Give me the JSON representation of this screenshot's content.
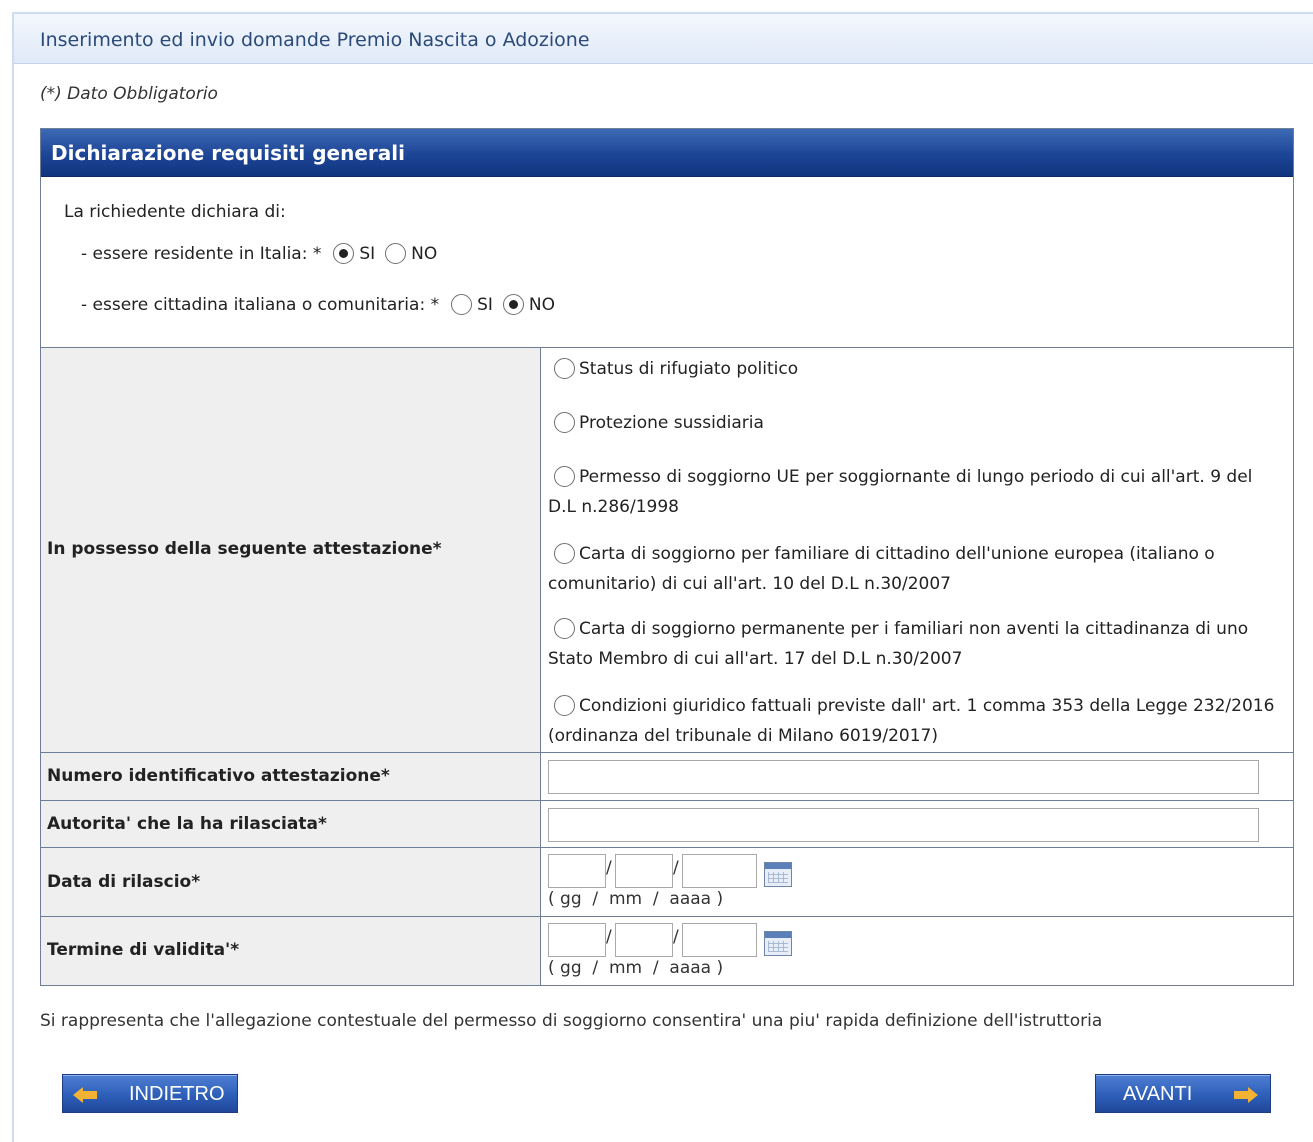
{
  "page": {
    "title": "Inserimento ed invio domande Premio Nascita o Adozione",
    "required_note": "(*) Dato Obbligatorio"
  },
  "section": {
    "title": "Dichiarazione requisiti generali",
    "intro": "La richiedente dichiara di:",
    "residente": {
      "question": "- essere residente in Italia: *",
      "options": [
        "SI",
        "NO"
      ],
      "selected": "SI"
    },
    "cittadina": {
      "question": "- essere cittadina italiana o comunitaria: *",
      "options": [
        "SI",
        "NO"
      ],
      "selected": "NO"
    },
    "attestazione": {
      "label": "In possesso della seguente attestazione*",
      "options": [
        "Status di rifugiato politico",
        "Protezione sussidiaria",
        "Permesso di soggiorno UE per soggiornante di lungo periodo di cui all'art. 9 del D.L n.286/1998",
        "Carta di soggiorno per familiare di cittadino dell'unione europea (italiano o comunitario) di cui all'art. 10 del D.L n.30/2007",
        "Carta di soggiorno permanente per i familiari non aventi la cittadinanza di uno Stato Membro di cui all'art. 17 del D.L n.30/2007",
        "Condizioni giuridico fattuali previste dall' art. 1 comma 353 della Legge 232/2016 (ordinanza del tribunale di Milano 6019/2017)"
      ]
    },
    "numero": {
      "label": "Numero identificativo attestazione*",
      "value": ""
    },
    "autorita": {
      "label": "Autorita' che la ha rilasciata*",
      "value": ""
    },
    "data_rilascio": {
      "label": "Data di rilascio*",
      "day": "",
      "month": "",
      "year": "",
      "hint": "( gg  /  mm  /  aaaa )"
    },
    "termine": {
      "label": "Termine di validita'*",
      "day": "",
      "month": "",
      "year": "",
      "hint": "( gg  /  mm  /  aaaa )"
    },
    "date_separator": "/"
  },
  "footnote": "Si rappresenta che l'allegazione contestuale del permesso di soggiorno consentira' una piu' rapida definizione dell'istruttoria",
  "buttons": {
    "back": "INDIETRO",
    "next": "AVANTI"
  }
}
